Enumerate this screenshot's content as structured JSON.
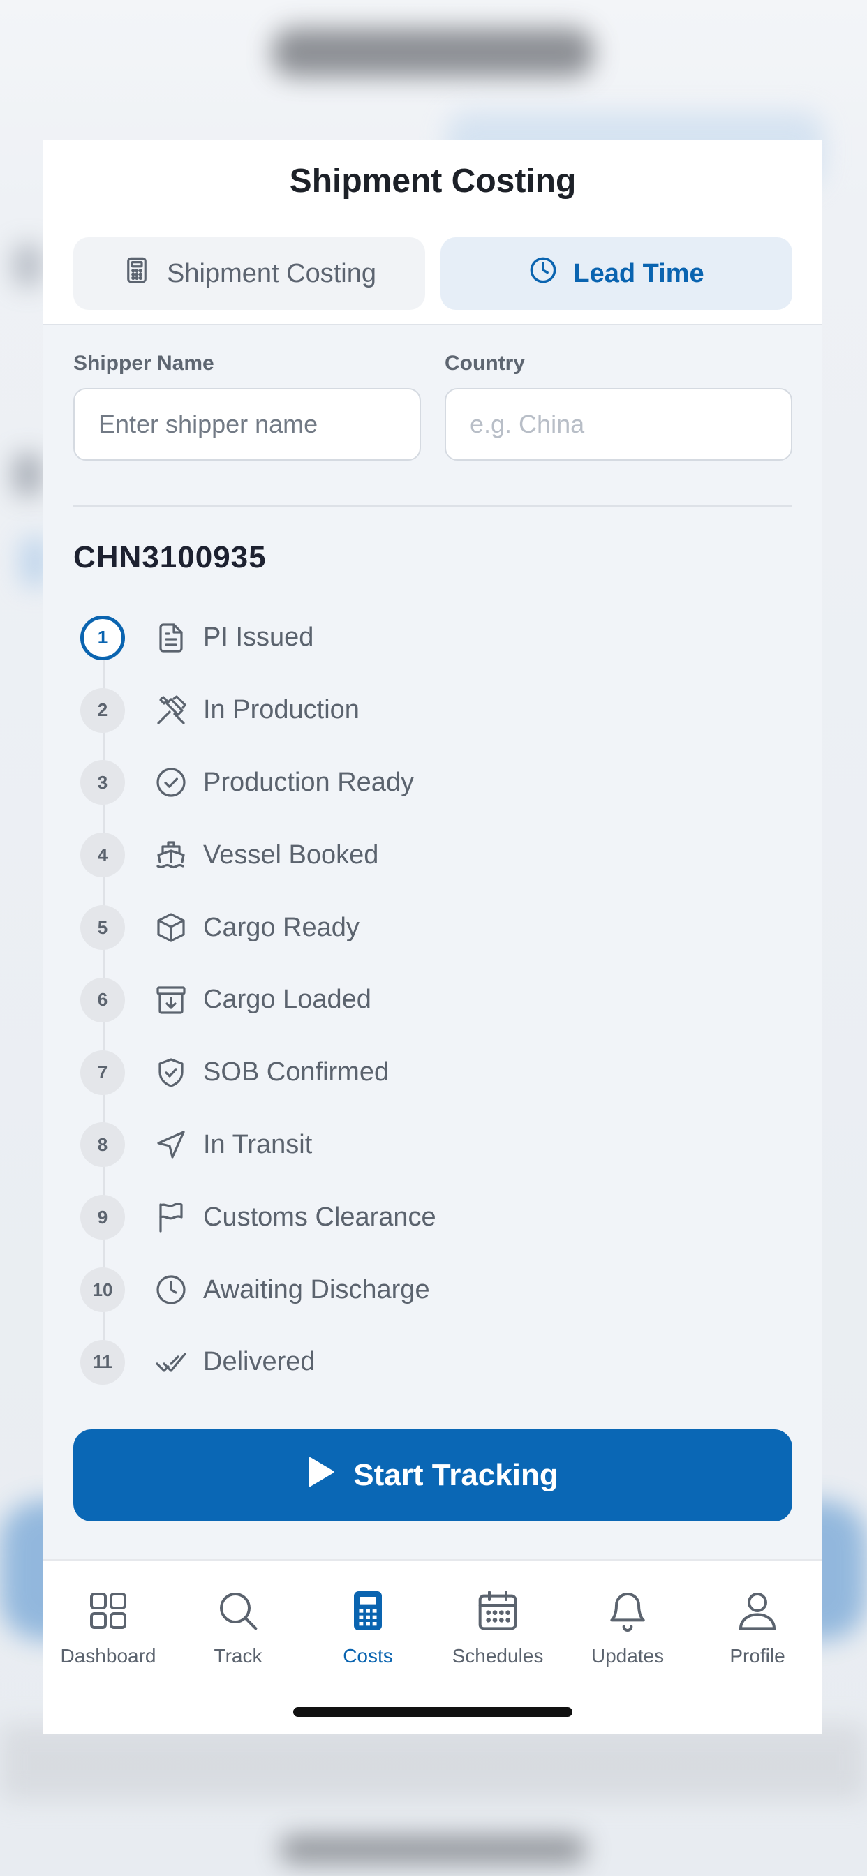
{
  "header": {
    "title": "Shipment Costing"
  },
  "tabs": [
    {
      "label": "Shipment Costing",
      "icon": "calculator-icon",
      "active": false
    },
    {
      "label": "Lead Time",
      "icon": "clock-icon",
      "active": true
    }
  ],
  "form": {
    "shipper_label": "Shipper Name",
    "shipper_placeholder": "Enter shipper name",
    "country_label": "Country",
    "country_placeholder": "e.g. China"
  },
  "reference": "CHN3100935",
  "steps": [
    {
      "num": "1",
      "label": "PI Issued",
      "icon": "document-icon"
    },
    {
      "num": "2",
      "label": "In Production",
      "icon": "tools-icon"
    },
    {
      "num": "3",
      "label": "Production Ready",
      "icon": "check-circle-icon"
    },
    {
      "num": "4",
      "label": "Vessel Booked",
      "icon": "ship-icon"
    },
    {
      "num": "5",
      "label": "Cargo Ready",
      "icon": "box-icon"
    },
    {
      "num": "6",
      "label": "Cargo Loaded",
      "icon": "archive-icon"
    },
    {
      "num": "7",
      "label": "SOB Confirmed",
      "icon": "shield-check-icon"
    },
    {
      "num": "8",
      "label": "In Transit",
      "icon": "navigation-icon"
    },
    {
      "num": "9",
      "label": "Customs Clearance",
      "icon": "flag-icon"
    },
    {
      "num": "10",
      "label": "Awaiting Discharge",
      "icon": "clock-icon"
    },
    {
      "num": "11",
      "label": "Delivered",
      "icon": "double-check-icon"
    }
  ],
  "start_button": {
    "label": "Start Tracking",
    "icon": "play-icon"
  },
  "tabbar": [
    {
      "label": "Dashboard",
      "icon": "grid-icon"
    },
    {
      "label": "Track",
      "icon": "search-icon"
    },
    {
      "label": "Costs",
      "icon": "calculator-icon",
      "active": true
    },
    {
      "label": "Schedules",
      "icon": "calendar-icon"
    },
    {
      "label": "Updates",
      "icon": "bell-icon"
    },
    {
      "label": "Profile",
      "icon": "user-icon"
    }
  ],
  "colors": {
    "accent": "#0a64b0",
    "button": "#0a67b5",
    "muted": "#5b636e"
  }
}
